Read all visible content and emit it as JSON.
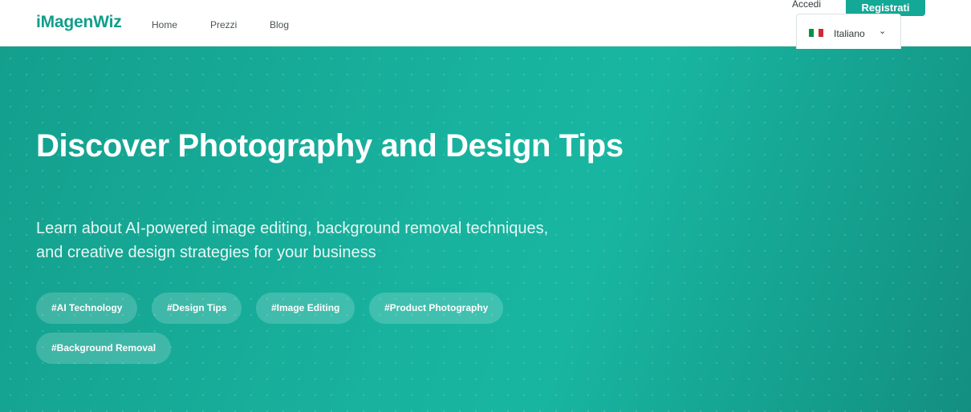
{
  "header": {
    "logo": "iMagenWiz",
    "nav": [
      {
        "label": "Home"
      },
      {
        "label": "Prezzi"
      },
      {
        "label": "Blog"
      }
    ],
    "login_label": "Accedi",
    "register_label": "Registrati",
    "language": {
      "selected": "Italiano",
      "flag_colors": [
        "#009246",
        "#ffffff",
        "#ce2b37"
      ],
      "chevron_icon": "chevron-down-icon"
    }
  },
  "hero": {
    "title": "Discover Photography and Design Tips",
    "subtitle": "Learn about AI-powered image editing, background removal techniques, and creative design strategies for your business",
    "tags": [
      "#AI Technology",
      "#Design Tips",
      "#Image Editing",
      "#Product Photography",
      "#Background Removal"
    ]
  },
  "colors": {
    "accent": "#14a896",
    "hero_gradient_start": "#149f8d",
    "hero_gradient_end": "#138f80"
  }
}
